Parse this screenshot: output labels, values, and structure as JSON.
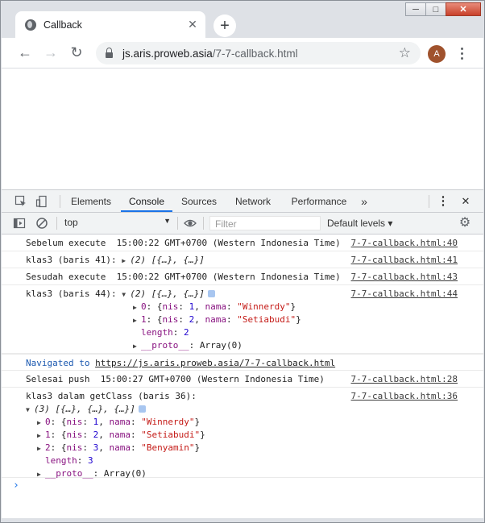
{
  "window": {
    "minimize": "─",
    "maximize": "□",
    "close": "✕"
  },
  "tab": {
    "title": "Callback",
    "close": "✕",
    "new_tab": "+"
  },
  "toolbar": {
    "back": "←",
    "forward": "→",
    "reload": "↻",
    "url_host": "js.aris.proweb.asia",
    "url_path": "/7-7-callback.html",
    "star": "☆",
    "avatar": "A"
  },
  "devtools": {
    "tabs": [
      "Elements",
      "Console",
      "Sources",
      "Network",
      "Performance"
    ],
    "more": "»",
    "kebab": "⋮",
    "close": "✕",
    "context": "top",
    "context_arrow": "▼",
    "filter_placeholder": "Filter",
    "levels": "Default levels ▾",
    "settings": "⚙"
  },
  "console": {
    "rows": [
      {
        "msg": "Sebelum execute  15:00:22 GMT+0700 (Western Indonesia Time)",
        "src": "7-7-callback.html:40"
      },
      {
        "msg_prefix": "klas3 (baris 41): ",
        "msg_obj": "(2) [{…}, {…}]",
        "src": "7-7-callback.html:41"
      },
      {
        "msg": "Sesudah execute  15:00:22 GMT+0700 (Western Indonesia Time)",
        "src": "7-7-callback.html:43"
      },
      {
        "msg_prefix": "klas3 (baris 44): ",
        "msg_obj": "(2) [{…}, {…}]",
        "src": "7-7-callback.html:44"
      },
      {
        "msg": "Selesai push  15:00:27 GMT+0700 (Western Indonesia Time)",
        "src": "7-7-callback.html:28"
      },
      {
        "msg": "klas3 dalam getClass (baris 36):",
        "src": "7-7-callback.html:36"
      }
    ],
    "expand44": [
      {
        "idx": "0",
        "nis": "1",
        "nama": "\"Winnerdy\""
      },
      {
        "idx": "1",
        "nis": "2",
        "nama": "\"Setiabudi\""
      }
    ],
    "length44": "2",
    "proto": "__proto__",
    "proto_val": "Array(0)",
    "navigated_label": "Navigated to ",
    "navigated_url": "https://js.aris.proweb.asia/7-7-callback.html",
    "obj36": "(3) [{…}, {…}, {…}]",
    "expand36": [
      {
        "idx": "0",
        "nis": "1",
        "nama": "\"Winnerdy\""
      },
      {
        "idx": "1",
        "nis": "2",
        "nama": "\"Setiabudi\""
      },
      {
        "idx": "2",
        "nis": "3",
        "nama": "\"Benyamin\""
      }
    ],
    "length36": "3",
    "prompt": "›"
  }
}
